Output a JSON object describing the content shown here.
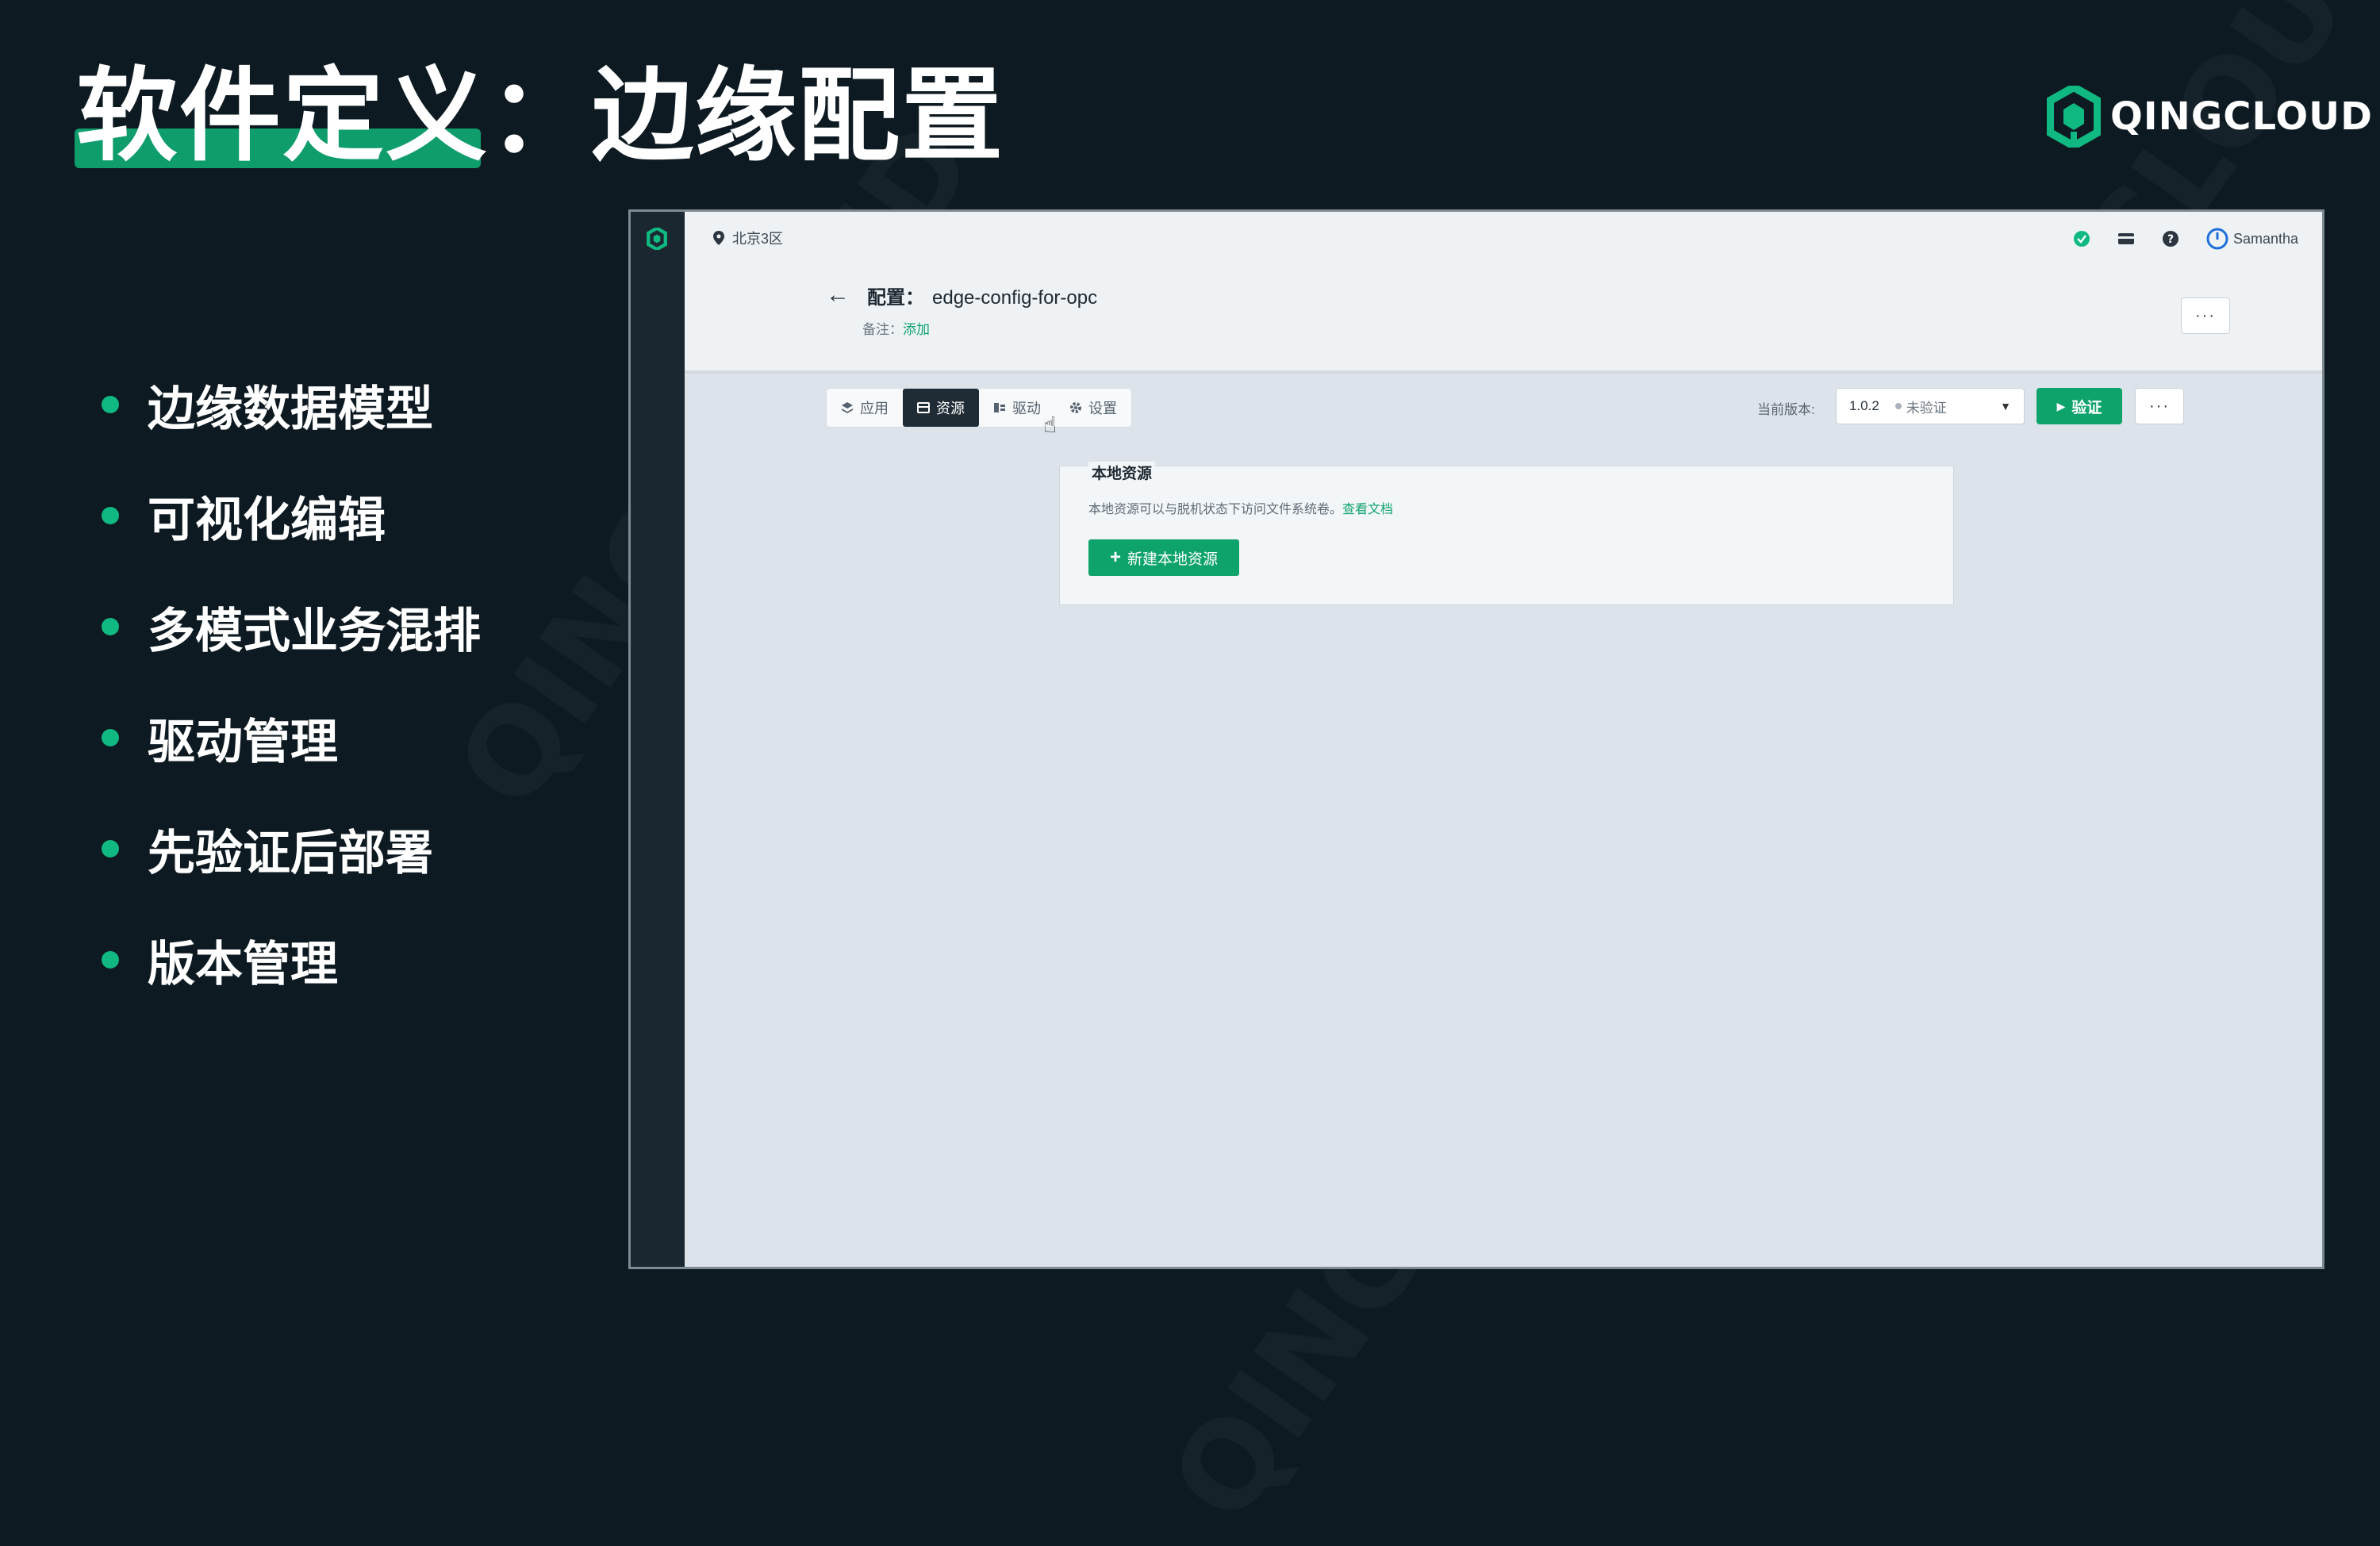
{
  "slide": {
    "title": "软件定义：边缘配置",
    "brand": "QINGCLOUD",
    "bullets": [
      "边缘数据模型",
      "可视化编辑",
      "多模式业务混排",
      "驱动管理",
      "先验证后部署",
      "版本管理"
    ]
  },
  "app": {
    "region": "北京3区",
    "user": "Samantha",
    "page_title_prefix": "配置：",
    "config_name": "edge-config-for-opc",
    "remark_label": "备注：",
    "remark_link": "添加",
    "more_label": "···",
    "tabs": [
      {
        "label": "应用",
        "icon": "layers-icon"
      },
      {
        "label": "资源",
        "icon": "storage-icon"
      },
      {
        "label": "驱动",
        "icon": "driver-icon"
      },
      {
        "label": "设置",
        "icon": "gear-icon"
      }
    ],
    "active_tab": "资源",
    "version_label": "当前版本:",
    "version": "1.0.2",
    "version_status": "未验证",
    "verify_label": "验证",
    "card": {
      "title": "本地资源",
      "description": "本地资源可以与脱机状态下访问文件系统卷。",
      "doc_link": "查看文档",
      "add_button": "新建本地资源"
    },
    "colors": {
      "accent": "#0fa36c",
      "dark": "#1f2c36",
      "background": "#0e1a22"
    }
  }
}
